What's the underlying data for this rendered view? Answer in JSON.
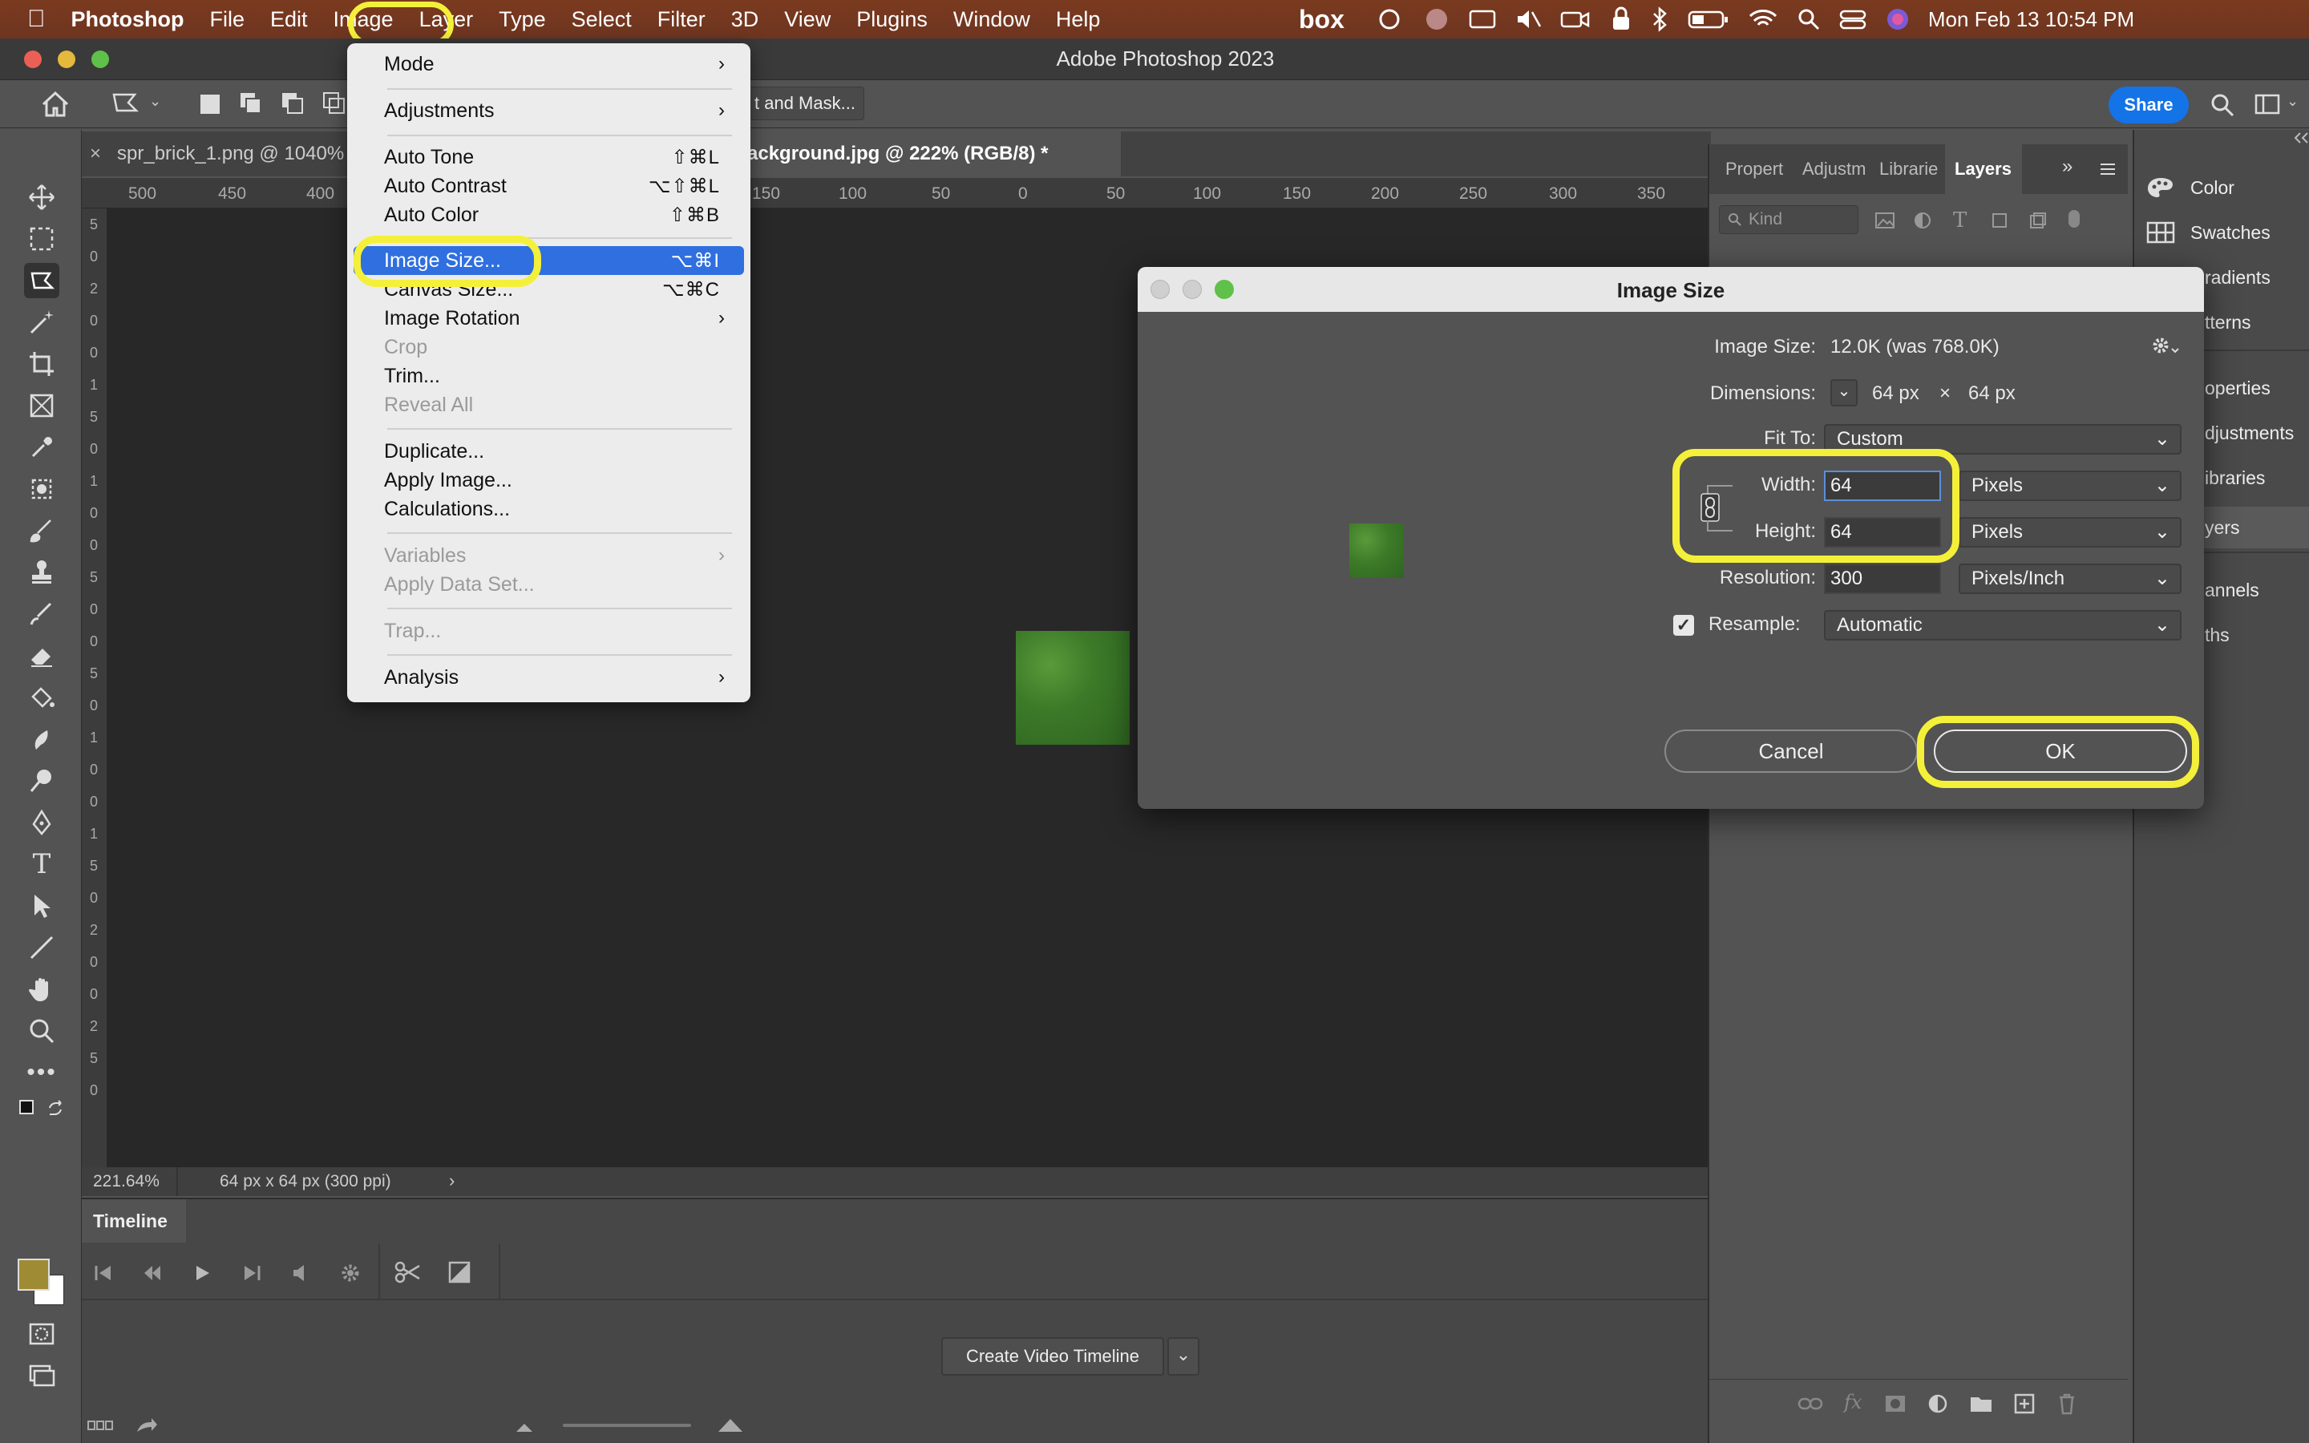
{
  "menubar": {
    "app_name": "Photoshop",
    "items": [
      "File",
      "Edit",
      "Image",
      "Layer",
      "Type",
      "Select",
      "Filter",
      "3D",
      "View",
      "Plugins",
      "Window",
      "Help"
    ],
    "datetime": "Mon Feb 13  10:54 PM",
    "box_label": "box"
  },
  "window": {
    "title": "Adobe Photoshop 2023"
  },
  "options": {
    "select_mask_label": "t and Mask...",
    "share_label": "Share"
  },
  "tabs": [
    {
      "label": "spr_brick_1.png @ 1040%"
    },
    {
      "label": "ackground.jpg @ 222% (RGB/8) *"
    }
  ],
  "ruler": {
    "h_ticks": [
      "500",
      "450",
      "400",
      "150",
      "100",
      "50",
      "0",
      "50",
      "100",
      "150",
      "200",
      "250",
      "300",
      "350"
    ],
    "v_ticks": [
      "5",
      "0",
      "2",
      "0",
      "0",
      "1",
      "5",
      "0",
      "1",
      "0",
      "0",
      "5",
      "0",
      "0",
      "5",
      "0",
      "1",
      "0",
      "0",
      "1",
      "5",
      "0",
      "2",
      "0",
      "0",
      "2",
      "5",
      "0"
    ]
  },
  "image_menu": {
    "items": [
      {
        "label": "Mode",
        "shortcut": "",
        "submenu": true,
        "disabled": false
      },
      {
        "label": "Adjustments",
        "shortcut": "",
        "submenu": true,
        "disabled": false
      },
      {
        "label": "Auto Tone",
        "shortcut": "⇧⌘L",
        "submenu": false,
        "disabled": false
      },
      {
        "label": "Auto Contrast",
        "shortcut": "⌥⇧⌘L",
        "submenu": false,
        "disabled": false
      },
      {
        "label": "Auto Color",
        "shortcut": "⇧⌘B",
        "submenu": false,
        "disabled": false
      },
      {
        "label": "Image Size...",
        "shortcut": "⌥⌘I",
        "submenu": false,
        "disabled": false,
        "highlighted": true
      },
      {
        "label": "Canvas Size...",
        "shortcut": "⌥⌘C",
        "submenu": false,
        "disabled": false
      },
      {
        "label": "Image Rotation",
        "shortcut": "",
        "submenu": true,
        "disabled": false
      },
      {
        "label": "Crop",
        "shortcut": "",
        "submenu": false,
        "disabled": true
      },
      {
        "label": "Trim...",
        "shortcut": "",
        "submenu": false,
        "disabled": false
      },
      {
        "label": "Reveal All",
        "shortcut": "",
        "submenu": false,
        "disabled": true
      },
      {
        "label": "Duplicate...",
        "shortcut": "",
        "submenu": false,
        "disabled": false
      },
      {
        "label": "Apply Image...",
        "shortcut": "",
        "submenu": false,
        "disabled": false
      },
      {
        "label": "Calculations...",
        "shortcut": "",
        "submenu": false,
        "disabled": false
      },
      {
        "label": "Variables",
        "shortcut": "",
        "submenu": true,
        "disabled": true
      },
      {
        "label": "Apply Data Set...",
        "shortcut": "",
        "submenu": false,
        "disabled": true
      },
      {
        "label": "Trap...",
        "shortcut": "",
        "submenu": false,
        "disabled": true
      },
      {
        "label": "Analysis",
        "shortcut": "",
        "submenu": true,
        "disabled": false
      }
    ]
  },
  "dialog": {
    "title": "Image Size",
    "image_size_label": "Image Size:",
    "image_size_value": "12.0K (was 768.0K)",
    "dimensions_label": "Dimensions:",
    "dimensions_w": "64 px",
    "dimensions_x": "×",
    "dimensions_h": "64 px",
    "fit_to_label": "Fit To:",
    "fit_to_value": "Custom",
    "width_label": "Width:",
    "width_value": "64",
    "width_unit": "Pixels",
    "height_label": "Height:",
    "height_value": "64",
    "height_unit": "Pixels",
    "resolution_label": "Resolution:",
    "resolution_value": "300",
    "resolution_unit": "Pixels/Inch",
    "resample_label": "Resample:",
    "resample_value": "Automatic",
    "resample_checked": true,
    "cancel_label": "Cancel",
    "ok_label": "OK"
  },
  "panels": {
    "tabs": [
      "Propert",
      "Adjustm",
      "Librarie",
      "Layers"
    ],
    "active_tab": "Layers",
    "search_placeholder": "Kind",
    "right_items": [
      "Color",
      "Swatches",
      "radients",
      "tterns",
      "operties",
      "djustments",
      "ibraries",
      "yers",
      "annels",
      "ths"
    ]
  },
  "status": {
    "zoom": "221.64%",
    "doc_info": "64 px x 64 px (300 ppi)"
  },
  "timeline": {
    "title": "Timeline",
    "create_label": "Create Video Timeline"
  },
  "colors": {
    "foreground": "#a08b35",
    "background": "#ffffff",
    "highlight": "#f4f03a",
    "menu_selection": "#2f6fe0",
    "share_blue": "#1473e6",
    "grass": "#3f7a2a"
  }
}
